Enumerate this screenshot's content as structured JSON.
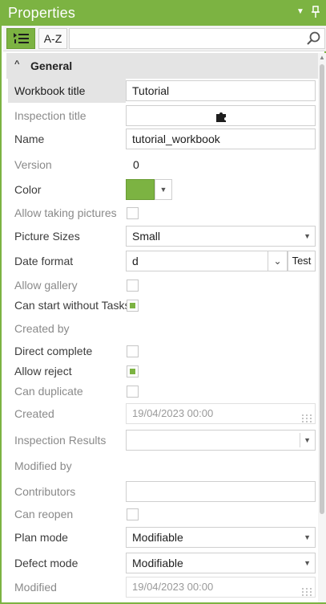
{
  "panel": {
    "title": "Properties",
    "pin_icon": "pin-icon",
    "menu_icon": "dropdown-menu-icon"
  },
  "toolbar": {
    "categorized_icon": "categorized-list-icon",
    "az_label": "A-Z",
    "search_value": "",
    "search_placeholder": "",
    "search_icon": "search-icon"
  },
  "group": {
    "title": "General",
    "expanded": true
  },
  "properties": {
    "workbook_title": {
      "label": "Workbook title",
      "value": "Tutorial"
    },
    "inspection_title": {
      "label": "Inspection title",
      "icon": "puzzle-icon"
    },
    "name": {
      "label": "Name",
      "value": "tutorial_workbook"
    },
    "version": {
      "label": "Version",
      "value": "0"
    },
    "color": {
      "label": "Color",
      "value": "#7cb342"
    },
    "allow_taking_pictures": {
      "label": "Allow taking pictures",
      "checked": false
    },
    "picture_sizes": {
      "label": "Picture Sizes",
      "value": "Small"
    },
    "date_format": {
      "label": "Date format",
      "value": "d",
      "test_label": "Test"
    },
    "allow_gallery": {
      "label": "Allow gallery",
      "checked": false
    },
    "can_start_without_task": {
      "label": "Can start without Tasks",
      "checked": true
    },
    "created_by": {
      "label": "Created by",
      "value": ""
    },
    "direct_complete": {
      "label": "Direct complete",
      "checked": false
    },
    "allow_reject": {
      "label": "Allow reject",
      "checked": true
    },
    "can_duplicate": {
      "label": "Can duplicate",
      "checked": false
    },
    "created": {
      "label": "Created",
      "value": "19/04/2023 00:00"
    },
    "inspection_results": {
      "label": "Inspection Results",
      "value": ""
    },
    "modified_by": {
      "label": "Modified by",
      "value": ""
    },
    "contributors": {
      "label": "Contributors",
      "value": ""
    },
    "can_reopen": {
      "label": "Can reopen",
      "checked": false
    },
    "plan_mode": {
      "label": "Plan mode",
      "value": "Modifiable"
    },
    "defect_mode": {
      "label": "Defect mode",
      "value": "Modifiable"
    },
    "modified": {
      "label": "Modified",
      "value": "19/04/2023 00:00"
    }
  },
  "colors": {
    "accent": "#7cb342",
    "selected_row": "#e4e4e4",
    "disabled_text": "#8a8a8a"
  }
}
